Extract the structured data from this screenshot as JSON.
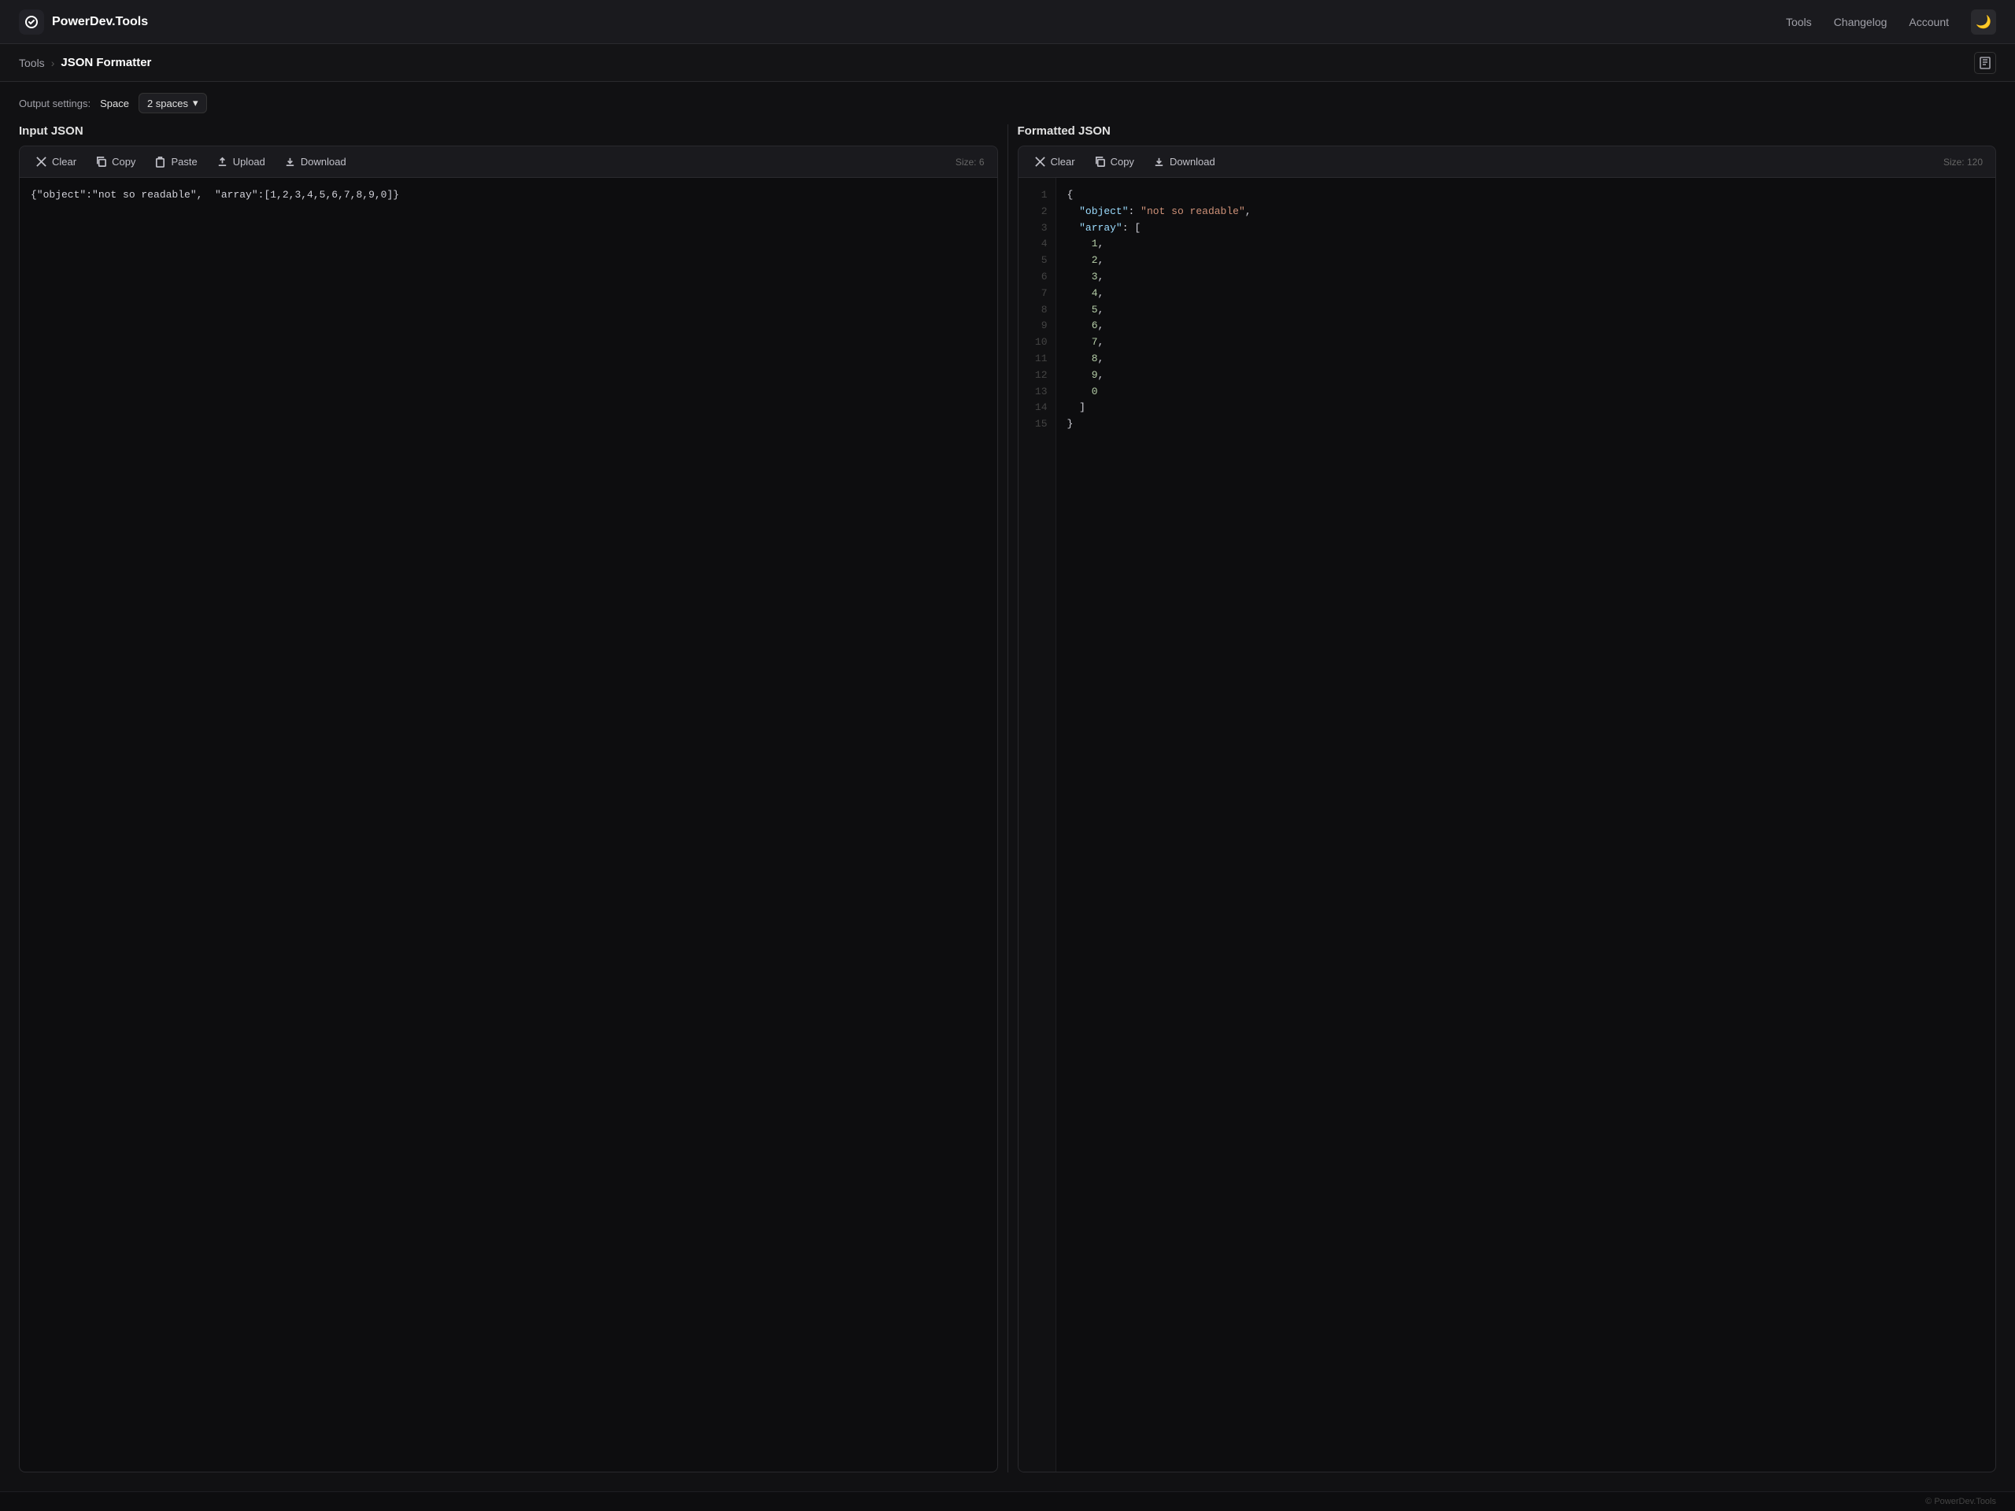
{
  "header": {
    "brand": "PowerDev.Tools",
    "nav": {
      "tools": "Tools",
      "changelog": "Changelog",
      "account": "Account"
    }
  },
  "breadcrumb": {
    "tools": "Tools",
    "current": "JSON Formatter"
  },
  "settings": {
    "label": "Output settings:",
    "space_label": "Space",
    "space_value": "2 spaces"
  },
  "input_panel": {
    "title": "Input JSON",
    "toolbar": {
      "clear": "Clear",
      "copy": "Copy",
      "paste": "Paste",
      "upload": "Upload",
      "download": "Download",
      "size": "Size: 6"
    },
    "value": "{\"object\":\"not so readable\",  \"array\":[1,2,3,4,5,6,7,8,9,0]}"
  },
  "output_panel": {
    "title": "Formatted JSON",
    "toolbar": {
      "clear": "Clear",
      "copy": "Copy",
      "download": "Download",
      "size": "Size: 120"
    },
    "lines": [
      "{",
      "  \"object\": \"not so readable\",",
      "  \"array\": [",
      "    1,",
      "    2,",
      "    3,",
      "    4,",
      "    5,",
      "    6,",
      "    7,",
      "    8,",
      "    9,",
      "    0",
      "  ]",
      "}"
    ]
  },
  "footer": {
    "text": "© PowerDev.Tools"
  }
}
